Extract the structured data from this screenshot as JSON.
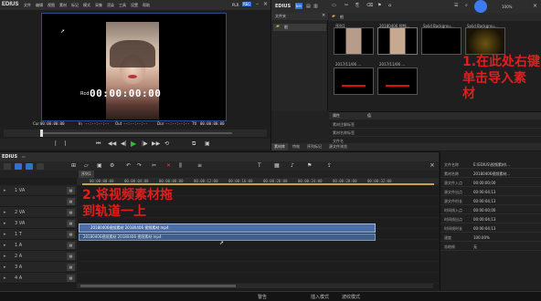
{
  "app": {
    "name": "EDIUS",
    "menu": [
      "文件",
      "编辑",
      "视图",
      "素材",
      "标记",
      "模式",
      "采集",
      "渲染",
      "工具",
      "设置",
      "帮助"
    ],
    "plr": "PLR",
    "rec": "REC"
  },
  "player": {
    "timecode": "00:00:00:00",
    "tc_label": "Rcd",
    "cur_label": "Cur",
    "cur_value": "00:00:00:00",
    "in_label": "In",
    "in_value": "--:--:--:--",
    "out_label": "Out",
    "out_value": "--:--:--:--",
    "dur_label": "Dur",
    "dur_value": "--:--:--:--",
    "ttl_label": "Ttl",
    "ttl_value": "00:00:00:00"
  },
  "bin": {
    "title": "EDIUS",
    "folder_header": "文件夹",
    "root_folder": "根",
    "path": "根",
    "zoom": "100%",
    "clips": [
      {
        "label": "序列1"
      },
      {
        "label": "20180406 视频..."
      },
      {
        "label": "Solid Backgrou..."
      },
      {
        "label": "Solid Backgrou..."
      },
      {
        "label": "2017/11/06 ..."
      },
      {
        "label": "2017/11/06 ..."
      }
    ],
    "annotation": "1.在此处右键\n单击导入素\n材"
  },
  "properties": {
    "header": "属性",
    "value_header": "值",
    "rows": [
      {
        "key": "素材注解标签",
        "value": ""
      },
      {
        "key": "素材名称标签",
        "value": ""
      },
      {
        "key": "文件名",
        "value": ""
      }
    ],
    "tabs": [
      "素材库",
      "特效",
      "序列标记",
      "源文件浏览"
    ]
  },
  "timeline": {
    "sequence_name": "EDIUS",
    "sequence_tab": "序列1",
    "annotation": "2.将视频素材拖\n到轨道一上",
    "ticks": [
      "00:00:00:00",
      "00:00:04:00",
      "00:00:08:00",
      "00:00:12:00",
      "00:00:16:00",
      "00:00:20:00",
      "00:00:24:00",
      "00:00:28:00",
      "00:00:32:00"
    ],
    "tracks": [
      {
        "name": "1 VA"
      },
      {
        "name": "2 VA"
      },
      {
        "name": "3 VA"
      },
      {
        "name": "1 T"
      },
      {
        "name": "1 A"
      },
      {
        "name": "2 A"
      },
      {
        "name": "3 A"
      },
      {
        "name": "4 A"
      }
    ],
    "clip_label": "20180406视频素材 20180406 视频素材 mp4",
    "clip_label2": "20180406视频素材 20180406 视频素材 mp4"
  },
  "info_panel": {
    "rows": [
      {
        "key": "文件名称",
        "value": "E:\\EDIUS\\视频素材\\..."
      },
      {
        "key": "素材名称",
        "value": "20180406视频素材..."
      },
      {
        "key": "源文件入点",
        "value": "00:00:00;00"
      },
      {
        "key": "源文件出点",
        "value": "00:00:04;13"
      },
      {
        "key": "源文件时长",
        "value": "00:00:04;13"
      },
      {
        "key": "时间线入点",
        "value": "00:00:00;00"
      },
      {
        "key": "时间线出点",
        "value": "00:00:04;13"
      },
      {
        "key": "时间线时长",
        "value": "00:00:04;13"
      },
      {
        "key": "速度",
        "value": "100.00%"
      },
      {
        "key": "冻结帧",
        "value": "无"
      }
    ]
  },
  "status": {
    "left": "警告",
    "mid": "插入模式",
    "right": "波纹模式"
  }
}
